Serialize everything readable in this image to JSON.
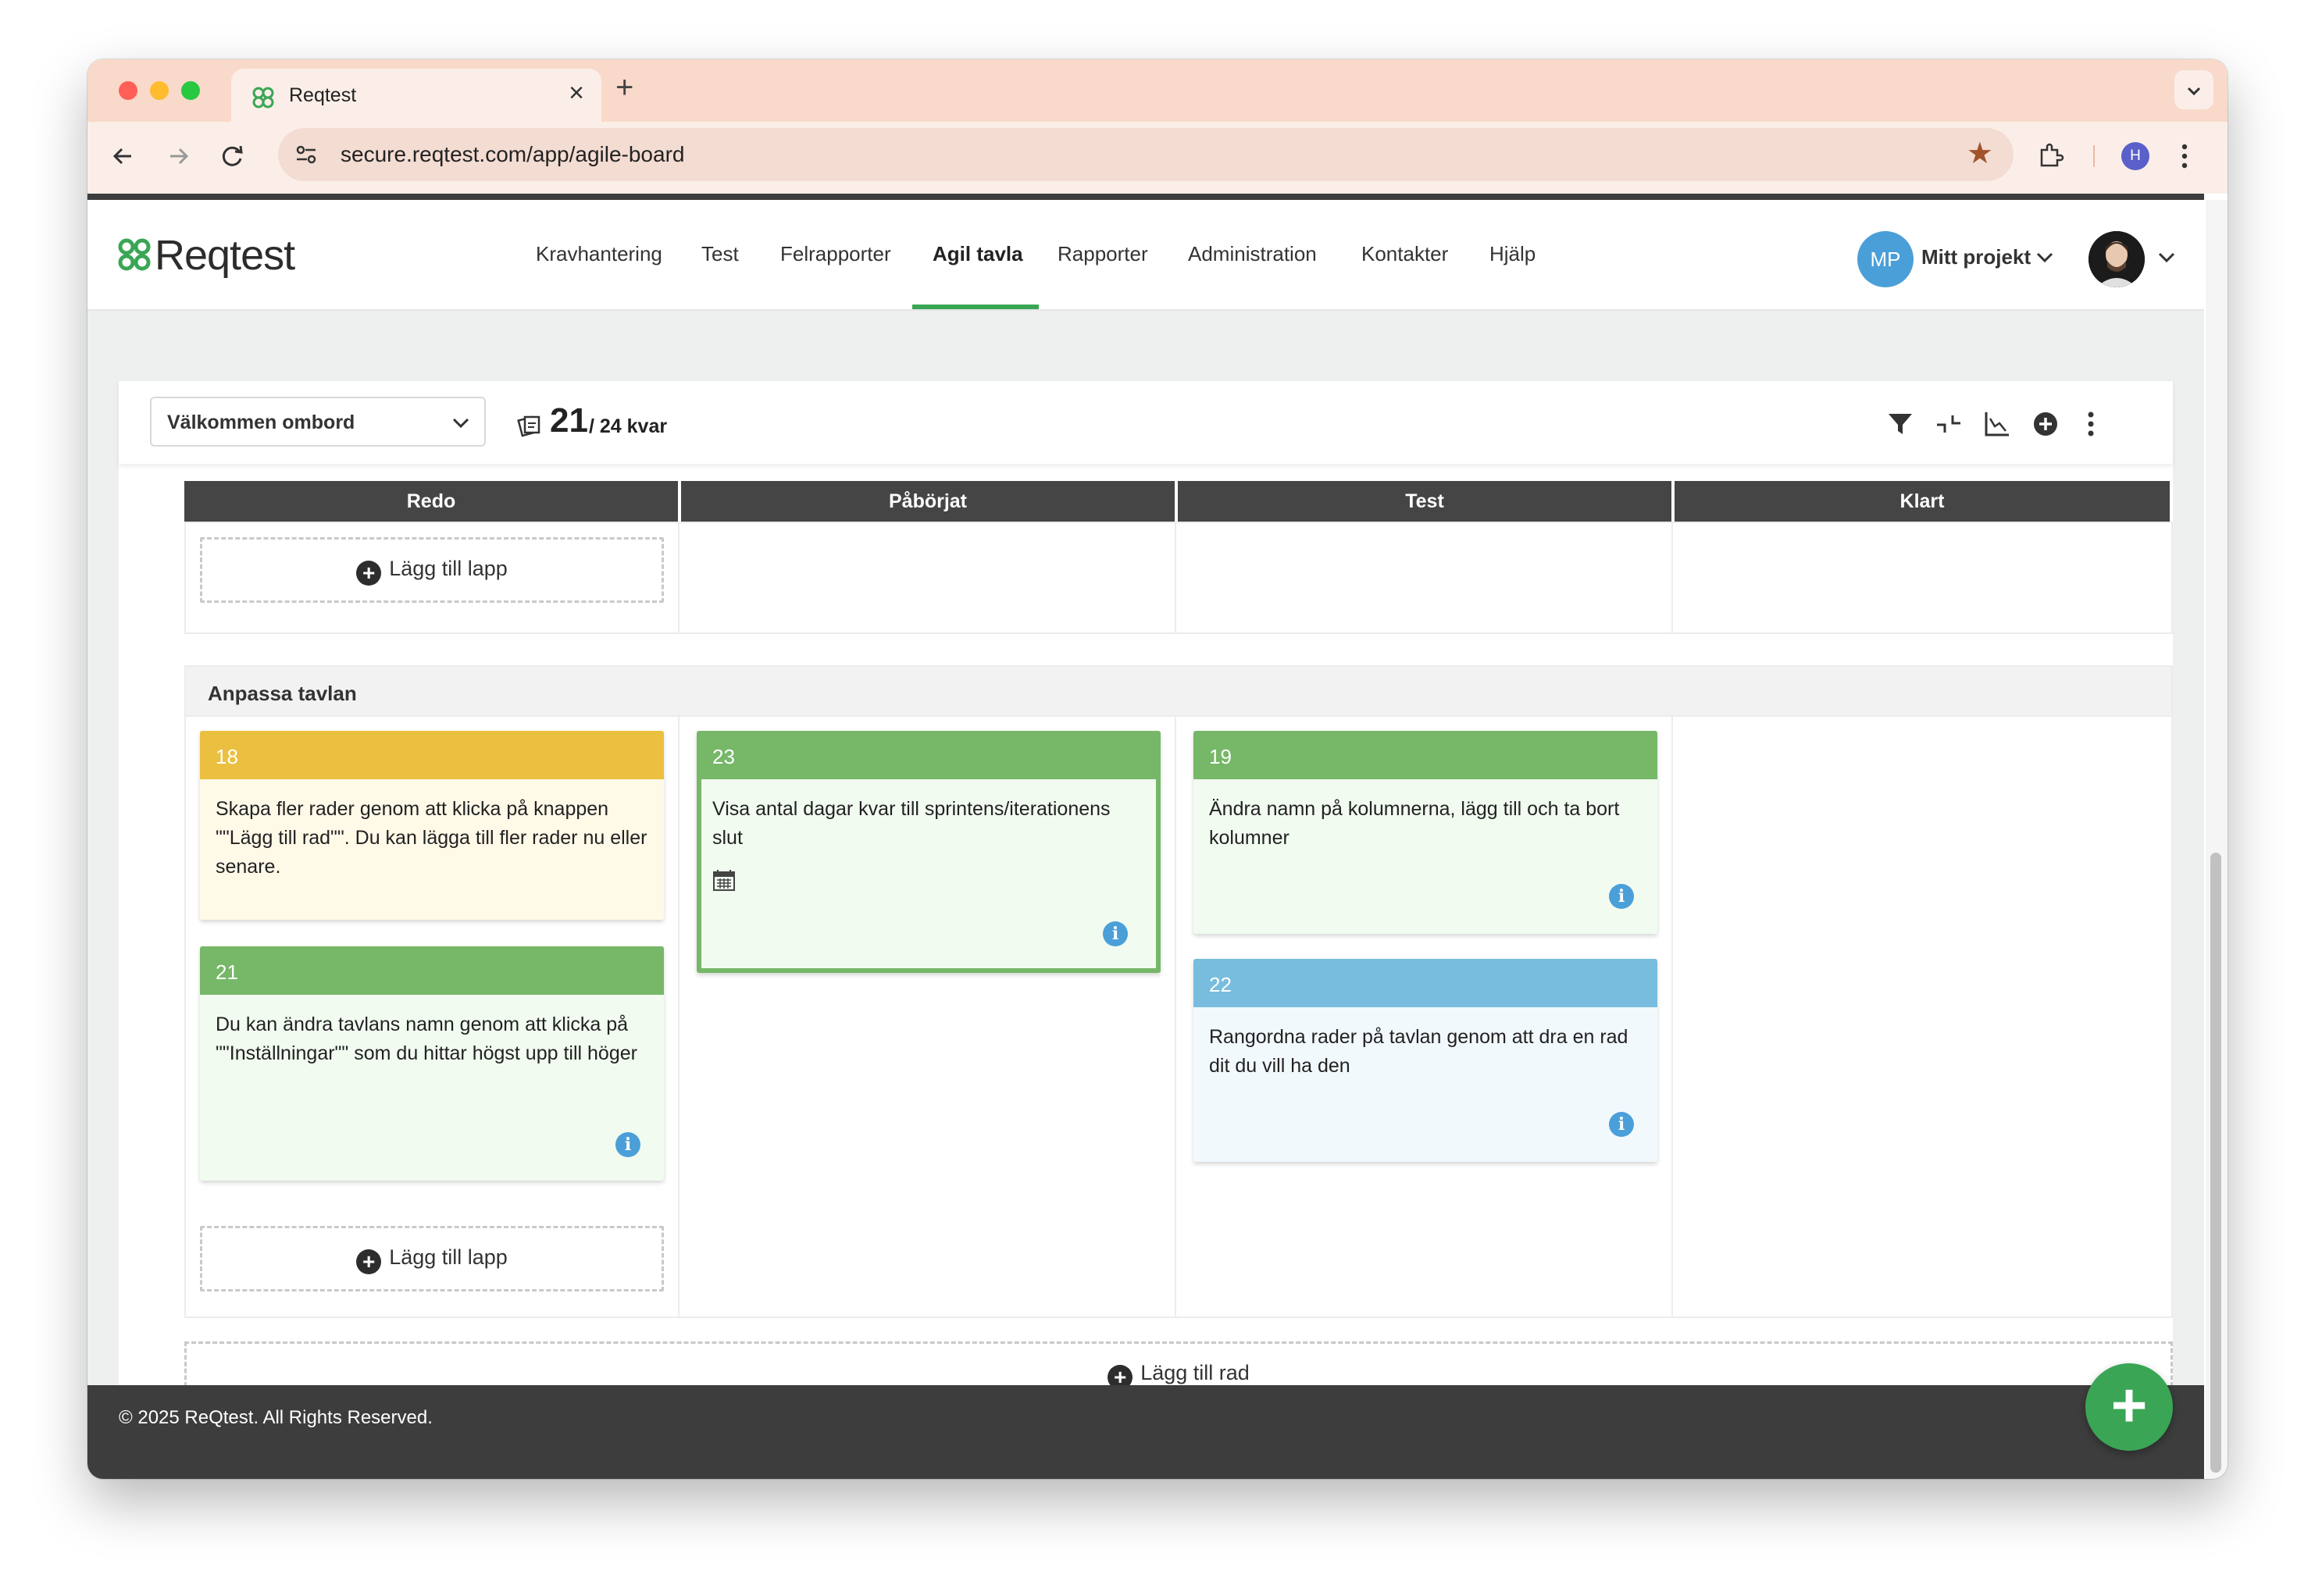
{
  "browser": {
    "tab_title": "Reqtest",
    "url": "secure.reqtest.com/app/agile-board",
    "profile_initial": "H"
  },
  "app": {
    "logo_text": "Reqtest",
    "nav": [
      "Kravhantering",
      "Test",
      "Felrapporter",
      "Agil tavla",
      "Rapporter",
      "Administration",
      "Kontakter",
      "Hjälp"
    ],
    "active_nav": "Agil tavla",
    "project_badge": "MP",
    "project_name": "Mitt projekt"
  },
  "board": {
    "selected_board": "Välkommen ombord",
    "cards_left": "21",
    "cards_total_text": "/ 24 kvar",
    "columns": [
      "Redo",
      "Påbörjat",
      "Test",
      "Klart"
    ],
    "add_card_label": "Lägg till lapp",
    "add_row_label": "Lägg till rad",
    "row2_title": "Anpassa tavlan",
    "cards": {
      "c18": {
        "id": "18",
        "text": "Skapa fler rader genom att klicka på knappen \"\"Lägg till rad\"\". Du kan lägga till fler rader nu eller senare."
      },
      "c21": {
        "id": "21",
        "text": "Du kan ändra tavlans namn genom att klicka på \"\"Inställningar\"\" som du hittar högst upp till höger"
      },
      "c23": {
        "id": "23",
        "text": "Visa antal dagar kvar till sprintens/iterationens slut"
      },
      "c19": {
        "id": "19",
        "text": "Ändra namn på kolumnerna, lägg till och ta bort kolumner"
      },
      "c22": {
        "id": "22",
        "text": "Rangordna rader på tavlan genom att dra en rad dit du vill ha den"
      }
    }
  },
  "footer": {
    "copyright": "© 2025 ReQtest. All Rights Reserved."
  },
  "colors": {
    "yellow_head": "#ebc040",
    "green_head": "#76b768",
    "blue_head": "#78bdde",
    "accent": "#3aa655"
  }
}
